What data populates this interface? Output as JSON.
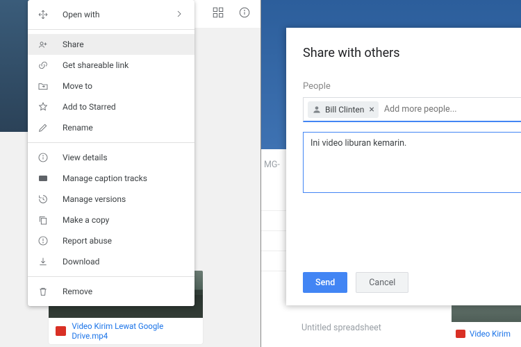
{
  "toolbar": {
    "grid_icon": "grid-view-icon",
    "info_icon": "info-icon"
  },
  "context_menu": {
    "open_with": "Open with",
    "share": "Share",
    "get_link": "Get shareable link",
    "move_to": "Move to",
    "add_star": "Add to Starred",
    "rename": "Rename",
    "view_details": "View details",
    "captions": "Manage caption tracks",
    "versions": "Manage versions",
    "make_copy": "Make a copy",
    "report": "Report abuse",
    "download": "Download",
    "remove": "Remove"
  },
  "thumb": {
    "name": "Video Kirim Lewat Google Drive.mp4"
  },
  "ghost": {
    "img_label": "MG-",
    "sheet_label": "Untitled spreadsheet",
    "video_label": "Video Kirim"
  },
  "dialog": {
    "title": "Share with others",
    "people_label": "People",
    "chip_name": "Bill Clinten",
    "placeholder": "Add more people...",
    "message": "Ini video liburan kemarin.",
    "send": "Send",
    "cancel": "Cancel"
  }
}
